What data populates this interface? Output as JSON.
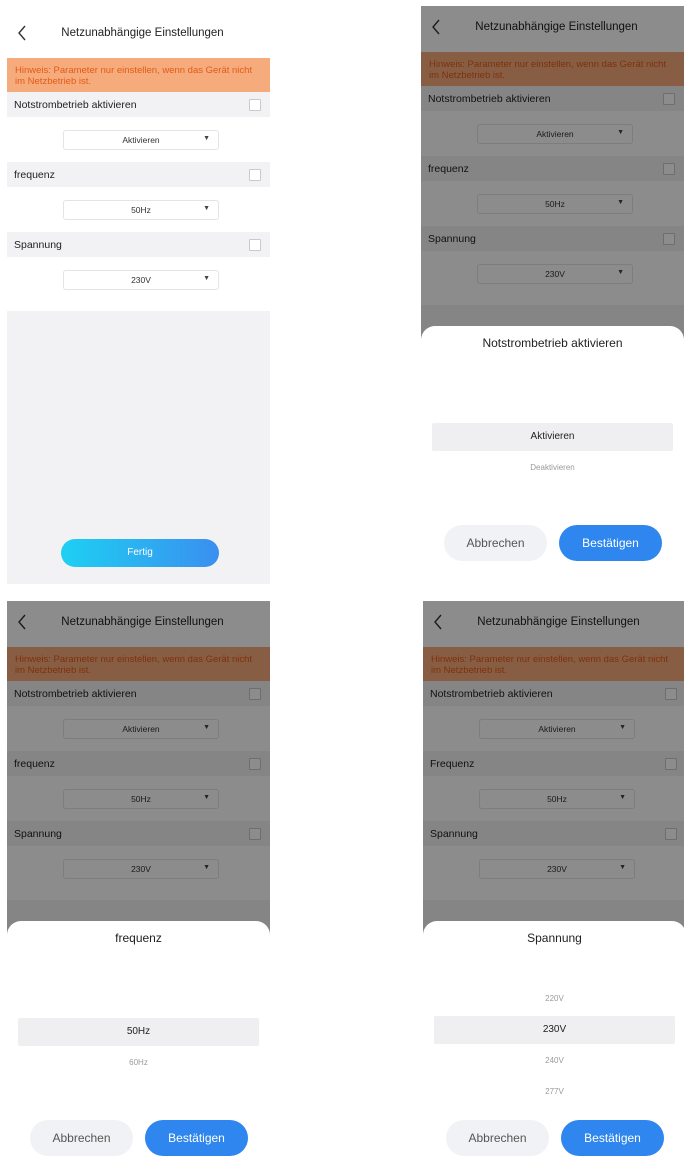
{
  "screen1": {
    "title": "Netzunabhängige Einstellungen",
    "notice": "Hinweis: Parameter nur einstellen, wenn das Gerät nicht im Netzbetrieb ist.",
    "rows": [
      {
        "label": "Notstrombetrieb aktivieren",
        "value": "Aktivieren"
      },
      {
        "label": "frequenz",
        "value": "50Hz"
      },
      {
        "label": "Spannung",
        "value": "230V"
      }
    ],
    "done_label": "Fertig"
  },
  "screen2": {
    "title": "Netzunabhängige Einstellungen",
    "notice": "Hinweis: Parameter nur einstellen, wenn das Gerät nicht im Netzbetrieb ist.",
    "rows": [
      {
        "label": "Notstrombetrieb aktivieren",
        "value": "Aktivieren"
      },
      {
        "label": "frequenz",
        "value": "50Hz"
      },
      {
        "label": "Spannung",
        "value": "230V"
      }
    ],
    "sheet": {
      "title": "Notstrombetrieb aktivieren",
      "options": [
        "Aktivieren",
        "Deaktivieren"
      ],
      "selected": "Aktivieren",
      "cancel": "Abbrechen",
      "confirm": "Bestätigen"
    }
  },
  "screen3": {
    "title": "Netzunabhängige Einstellungen",
    "notice": "Hinweis: Parameter nur einstellen, wenn das Gerät nicht im Netzbetrieb ist.",
    "rows": [
      {
        "label": "Notstrombetrieb aktivieren",
        "value": "Aktivieren"
      },
      {
        "label": "frequenz",
        "value": "50Hz"
      },
      {
        "label": "Spannung",
        "value": "230V"
      }
    ],
    "sheet": {
      "title": "frequenz",
      "options": [
        "50Hz",
        "60Hz"
      ],
      "selected": "50Hz",
      "cancel": "Abbrechen",
      "confirm": "Bestätigen"
    }
  },
  "screen4": {
    "title": "Netzunabhängige Einstellungen",
    "notice": "Hinweis: Parameter nur einstellen, wenn das Gerät nicht im Netzbetrieb ist.",
    "rows": [
      {
        "label": "Notstrombetrieb aktivieren",
        "value": "Aktivieren"
      },
      {
        "label": "Frequenz",
        "value": "50Hz"
      },
      {
        "label": "Spannung",
        "value": "230V"
      }
    ],
    "sheet": {
      "title": "Spannung",
      "options": [
        "220V",
        "230V",
        "240V",
        "277V"
      ],
      "selected": "230V",
      "cancel": "Abbrechen",
      "confirm": "Bestätigen"
    }
  },
  "colors": {
    "notice_bg": "#f6ab7c",
    "notice_text": "#e45a17",
    "confirm_blue": "#2f86ee",
    "fertig_gradient_start": "#1ed0f2",
    "fertig_gradient_end": "#3a8ff0"
  },
  "icons": {
    "back": "chevron-left-icon",
    "dropdown": "triangle-down-icon",
    "checkbox": "checkbox-empty"
  }
}
